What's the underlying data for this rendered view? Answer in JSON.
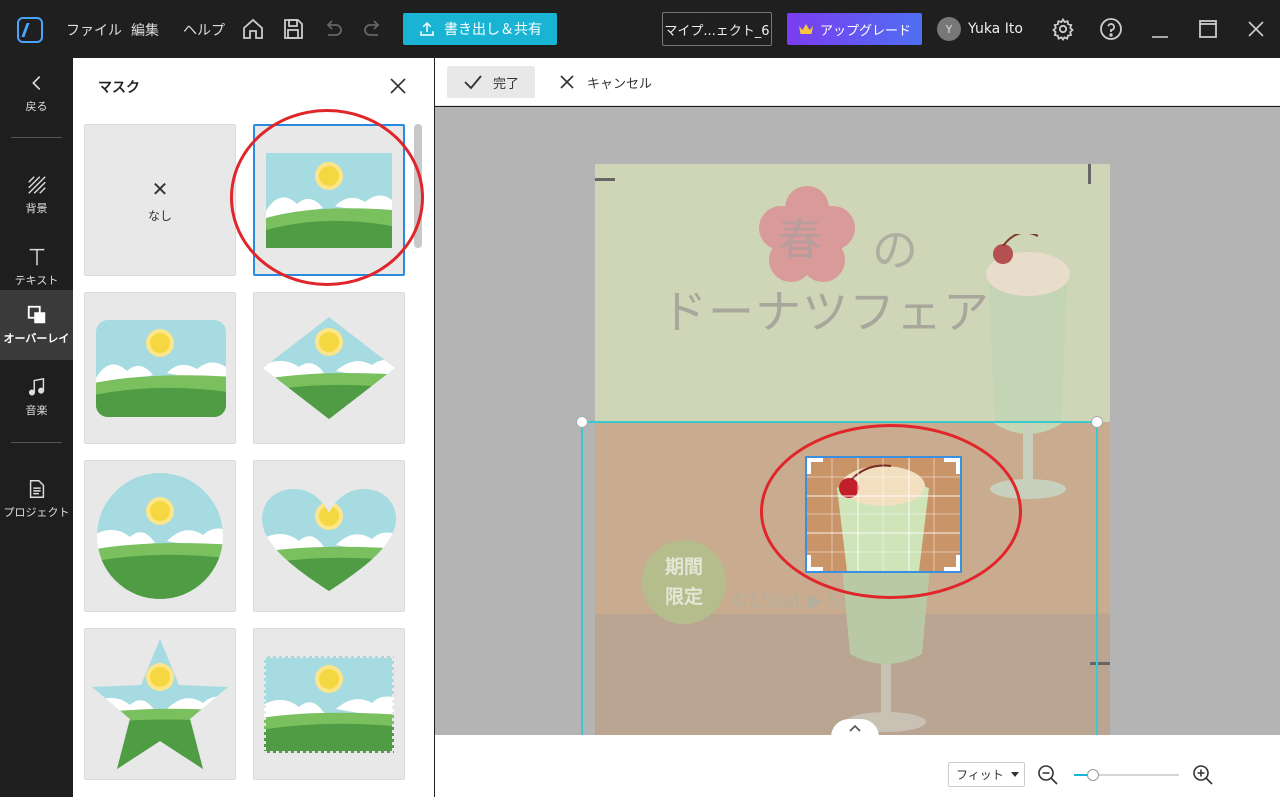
{
  "menu": {
    "file": "ファイル",
    "edit": "編集",
    "help": "ヘルプ"
  },
  "toolbar": {
    "export_label": "書き出し＆共有",
    "project_name": "マイプ...ェクト_6",
    "upgrade_label": "アップグレード",
    "user_initial": "Y",
    "user_name": "Yuka Ito"
  },
  "sidebar": {
    "items": [
      {
        "label": "戻る",
        "icon": "back-arrow-icon"
      },
      {
        "label": "背景",
        "icon": "hatch-icon"
      },
      {
        "label": "テキスト",
        "icon": "text-icon"
      },
      {
        "label": "オーバーレイ",
        "icon": "overlay-icon",
        "active": true
      },
      {
        "label": "音楽",
        "icon": "music-note-icon"
      },
      {
        "label": "プロジェクト",
        "icon": "document-icon"
      }
    ]
  },
  "mask_panel": {
    "title": "マスク",
    "none_label": "なし",
    "shapes": [
      "none",
      "rectangle",
      "rounded-rectangle",
      "diamond",
      "circle",
      "heart",
      "star",
      "stamp"
    ],
    "selected": "rectangle"
  },
  "edit_bar": {
    "done_label": "完了",
    "cancel_label": "キャンセル"
  },
  "poster": {
    "kanji": "春",
    "hiragana": "の",
    "title": "ドーナツフェア",
    "badge_line1": "期間",
    "badge_line2": "限定",
    "dates": "4/15sat ▶ 5/20fri"
  },
  "zoom": {
    "mode": "フィット",
    "level": 0.18
  },
  "colors": {
    "accent": "#19b4d4",
    "selection": "#3cc9cc",
    "annotation": "#e0262a",
    "upgrade": "#7b3cf0"
  }
}
